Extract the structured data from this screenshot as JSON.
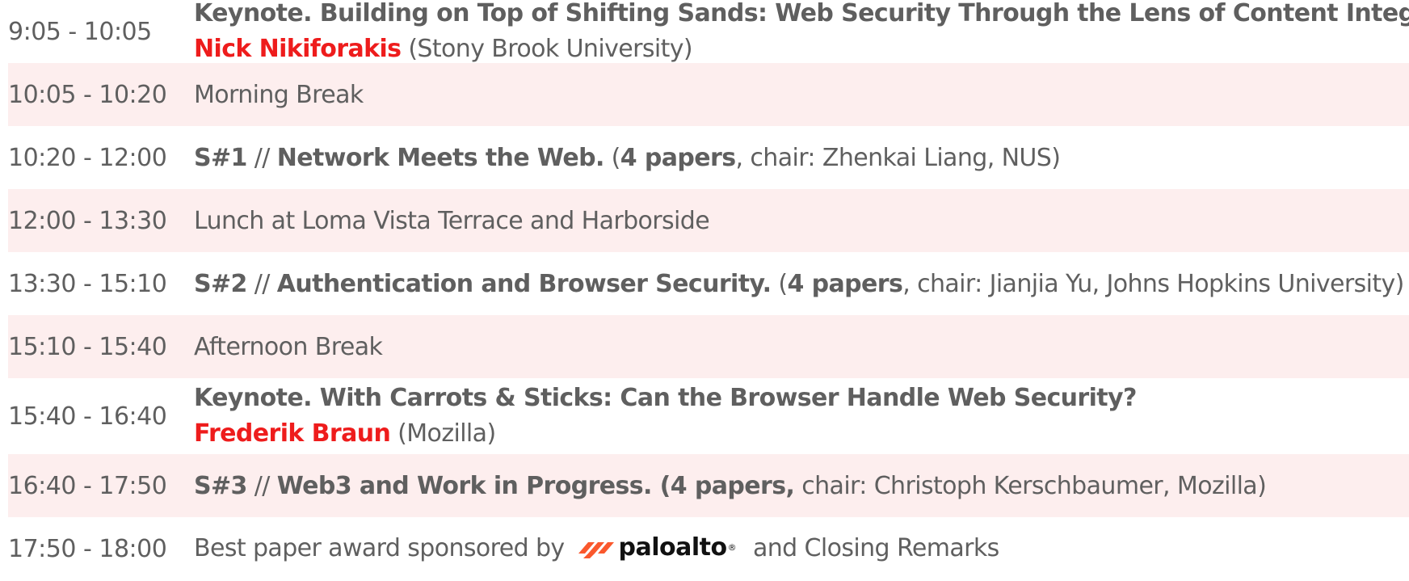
{
  "rows": [
    {
      "time": "9:05 - 10:05",
      "title": "Keynote. Building on Top of Shifting Sands: Web Security Through the Lens of Content Integrity",
      "speaker": "Nick Nikiforakis",
      "affiliation": " (Stony Brook University)"
    },
    {
      "time": "10:05 - 10:20",
      "text": "Morning Break"
    },
    {
      "time": "10:20 - 12:00",
      "session": "S#1",
      "sep": " // ",
      "name": "Network Meets the Web.",
      "open": " (",
      "papers": "4 papers",
      "rest": ", chair: Zhenkai Liang, NUS)"
    },
    {
      "time": "12:00 - 13:30",
      "text": "Lunch at Loma Vista Terrace and Harborside"
    },
    {
      "time": "13:30 - 15:10",
      "session": "S#2",
      "sep": " // ",
      "name": "Authentication and Browser Security.",
      "open": " (",
      "papers": "4 papers",
      "rest": ", chair: Jianjia Yu, Johns Hopkins University)"
    },
    {
      "time": "15:10 - 15:40",
      "text": "Afternoon Break"
    },
    {
      "time": "15:40 - 16:40",
      "title": "Keynote. With Carrots & Sticks: Can the Browser Handle Web Security?",
      "speaker": "Frederik Braun",
      "affiliation": " (Mozilla)"
    },
    {
      "time": "16:40 - 17:50",
      "session": "S#3",
      "sep": " // ",
      "name": "Web3 and Work in Progress. (4 papers,",
      "rest": " chair: Christoph Kerschbaumer, Mozilla)"
    },
    {
      "time": "17:50 - 18:00",
      "before": "Best paper award sponsored by",
      "logo": "paloalto",
      "after": "and Closing Remarks"
    }
  ],
  "colors": {
    "shade": "#fdeeee",
    "speaker": "#ee1c1c",
    "text": "#5f5f5f",
    "logo_mark": "#fa582d"
  },
  "icons": {
    "sponsor_logo": "paloalto-logo"
  }
}
